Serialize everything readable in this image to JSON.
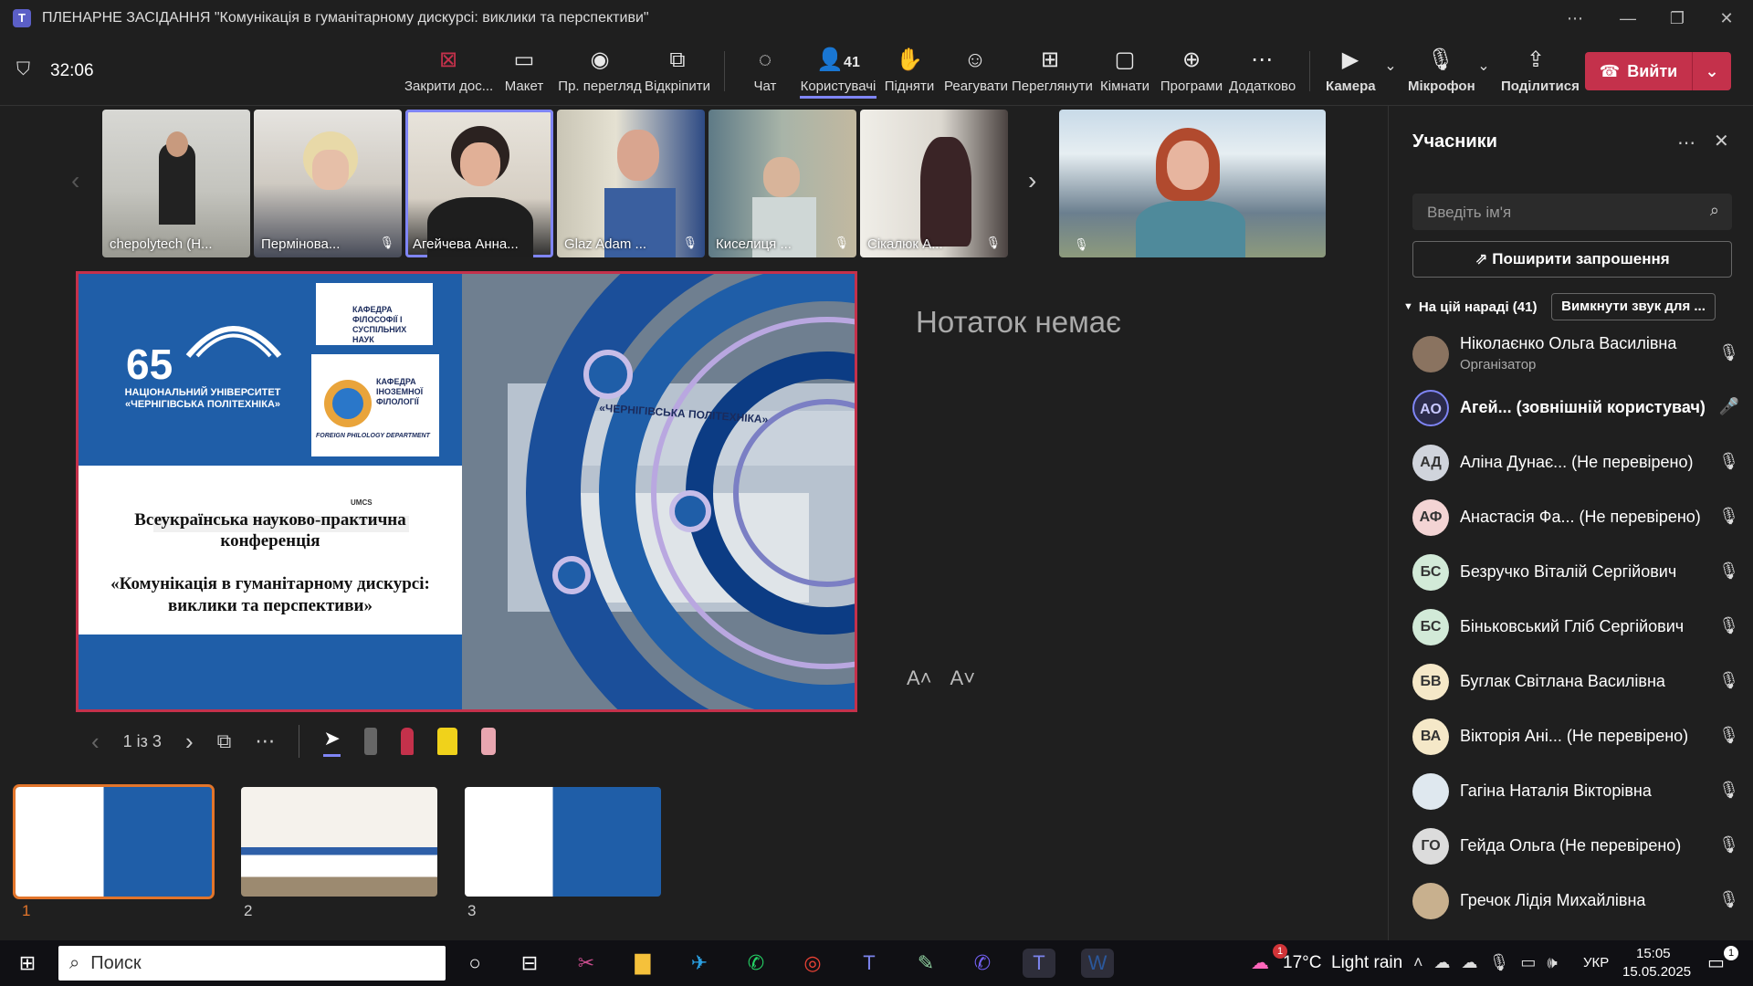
{
  "window": {
    "title": "ПЛЕНАРНЕ ЗАСІДАННЯ \"Комунікація в гуманітарному дискурсі: виклики та перспективи\"",
    "app_icon": "teams-icon"
  },
  "meeting": {
    "timer": "32:06"
  },
  "toolbar": {
    "close_share": "Закрити дос...",
    "layout": "Макет",
    "presenter_view": "Пр. перегляд",
    "popout": "Відкріпити",
    "chat": "Чат",
    "people": "Користувачі",
    "people_count": "41",
    "raise": "Підняти",
    "react": "Реагувати",
    "view": "Переглянути",
    "rooms": "Кімнати",
    "apps": "Програми",
    "more": "Додатково",
    "camera": "Камера",
    "mic": "Мікрофон",
    "share": "Поділитися",
    "leave": "Вийти"
  },
  "tiles": [
    "chepolytech (Н...",
    "Пермінова...",
    "Агейчева Анна...",
    "Glaz Adam ...",
    "Киселиця ...",
    "Сікалюк А...",
    ""
  ],
  "notes": {
    "empty": "Нотаток немає"
  },
  "slide_nav": {
    "page": "1 із 3"
  },
  "thumbnails": [
    "1",
    "2",
    "3"
  ],
  "slide": {
    "number": "65",
    "university": "НАЦІОНАЛЬНИЙ УНІВЕРСИТЕТ «ЧЕРНІГІВСЬКА ПОЛІТЕХНІКА»",
    "dept1": "КАФЕДРА ФІЛОСОФІЇ І СУСПІЛЬНИХ НАУК",
    "dept2": "КАФЕДРА ІНОЗЕМНОЇ ФІЛОЛОГІЇ",
    "dept2_en": "FOREIGN PHILOLOGY DEPARTMENT",
    "conf_type": "Всеукраїнська науково-практична конференція",
    "conf_title": "«Комунікація в гуманітарному дискурсі: виклики та перспективи»",
    "building_sign": "«ЧЕРНІГІВСЬКА ПОЛІТЕХНІКА»",
    "umcs": "UMCS"
  },
  "panel": {
    "title": "Учасники",
    "search_placeholder": "Введіть ім'я",
    "share_invite": "Поширити запрошення",
    "section": "На цій нараді (41)",
    "mute_all": "Вимкнути звук для ...",
    "participants": [
      {
        "initials": "",
        "name": "Ніколаєнко Ольга Василівна",
        "role": "Організатор",
        "color": "#8a7360"
      },
      {
        "initials": "АО",
        "name": "Агей... (зовнішній користувач)",
        "role": "",
        "color": "#2b2b4a"
      },
      {
        "initials": "АД",
        "name": "Аліна Дунає... (Не перевірено)",
        "role": "",
        "color": "#d0d4dc"
      },
      {
        "initials": "АФ",
        "name": "Анастасія Фа... (Не перевірено)",
        "role": "",
        "color": "#f3d4d4"
      },
      {
        "initials": "БС",
        "name": "Безручко Віталій Сергійович",
        "role": "",
        "color": "#d2ead8"
      },
      {
        "initials": "БС",
        "name": "Біньковський Гліб Сергійович",
        "role": "",
        "color": "#d2ead8"
      },
      {
        "initials": "БВ",
        "name": "Буглак Світлана Василівна",
        "role": "",
        "color": "#f5e8c8"
      },
      {
        "initials": "ВА",
        "name": "Вікторія Ані... (Не перевірено)",
        "role": "",
        "color": "#f5e8c8"
      },
      {
        "initials": "",
        "name": "Гагіна Наталія Вікторівна",
        "role": "",
        "color": "#dfe8ef"
      },
      {
        "initials": "ГО",
        "name": "Гейда Ольга (Не перевірено)",
        "role": "",
        "color": "#dcdcdc"
      },
      {
        "initials": "",
        "name": "Гречок Лідія Михайлівна",
        "role": "",
        "color": "#c8b08e"
      }
    ]
  },
  "taskbar": {
    "search": "Поиск",
    "weather": "17°C  Light rain",
    "lang": "УКР",
    "time": "15:05",
    "date": "15.05.2025",
    "notif": "1"
  }
}
